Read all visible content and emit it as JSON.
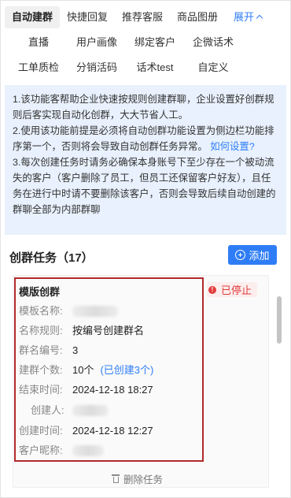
{
  "tabs": {
    "row1": [
      "自动建群",
      "快捷回复",
      "推荐客服",
      "商品图册"
    ],
    "expand_label": "展开",
    "row2": [
      "直播",
      "用户画像",
      "绑定客户",
      "企微话术"
    ],
    "row3": [
      "工单质检",
      "分销活码",
      "话术test",
      "自定义"
    ]
  },
  "notice": {
    "p1": "1.该功能客帮助企业快速按规则创建群聊，企业设置好创群规则后客实现自动化创群，大大节省人工。",
    "p2": "2.使用该功能前提是必须将自动创群功能设置为侧边栏功能排序第一个，否则将会导致自动创群任务异常。",
    "p2_link": "如何设置?",
    "p3": "3.每次创建任务时请务必确保本身账号下至少存在一个被动流失的客户（客户删除了员工，但员工还保留客户好友），且任务在进行中时请不要删除该客户，否则会导致后续自动创建的群聊全部为内部群聊"
  },
  "section": {
    "title": "创群任务（17）",
    "add_label": "添加"
  },
  "card": {
    "title": "模版创群",
    "status": "已停止",
    "template_label": "模板名称:",
    "rule_label": "名称规则:",
    "rule_value": "按编号创建群名",
    "number_label": "群名编号:",
    "number_value": "3",
    "count_label": "建群个数:",
    "count_value": "10个",
    "count_sub": "(已创建3个)",
    "end_label": "结束时间:",
    "end_value": "2024-12-18 18:27",
    "creator_label": "创建人:",
    "created_label": "创建时间:",
    "created_value": "2024-12-18 12:27",
    "nickname_label": "客户昵称:",
    "delete_label": "删除任务"
  }
}
